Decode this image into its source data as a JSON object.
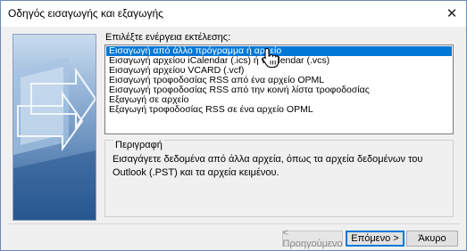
{
  "window": {
    "title": "Οδηγός εισαγωγής και εξαγωγής",
    "close_glyph": "✕"
  },
  "actions": {
    "label": "Επιλέξτε ενέργεια εκτέλεσης:",
    "items": [
      "Εισαγωγή από άλλο πρόγραμμα ή αρχείο",
      "Εισαγωγή αρχείου iCalendar (.ics) ή vCalendar (.vcs)",
      "Εισαγωγή αρχείου VCARD (.vcf)",
      "Εισαγωγή τροφοδοσίας RSS από ένα αρχείο OPML",
      "Εισαγωγή τροφοδοσίας RSS από την κοινή λίστα τροφοδοσίας",
      "Εξαγωγή σε αρχείο",
      "Εξαγωγή τροφοδοσίας RSS σε ένα αρχείο OPML"
    ],
    "selected_index": 0
  },
  "description": {
    "legend": "Περιγραφή",
    "text": "Εισαγάγετε δεδομένα από άλλα αρχεία, όπως τα αρχεία δεδομένων του Outlook (.PST) και τα αρχεία κειμένου."
  },
  "buttons": {
    "back": "< Προηγούμενο",
    "next": "Επόμενο >",
    "cancel": "Άκυρο"
  },
  "colors": {
    "selection": "#0078d7",
    "default_button_border": "#0078d7"
  }
}
